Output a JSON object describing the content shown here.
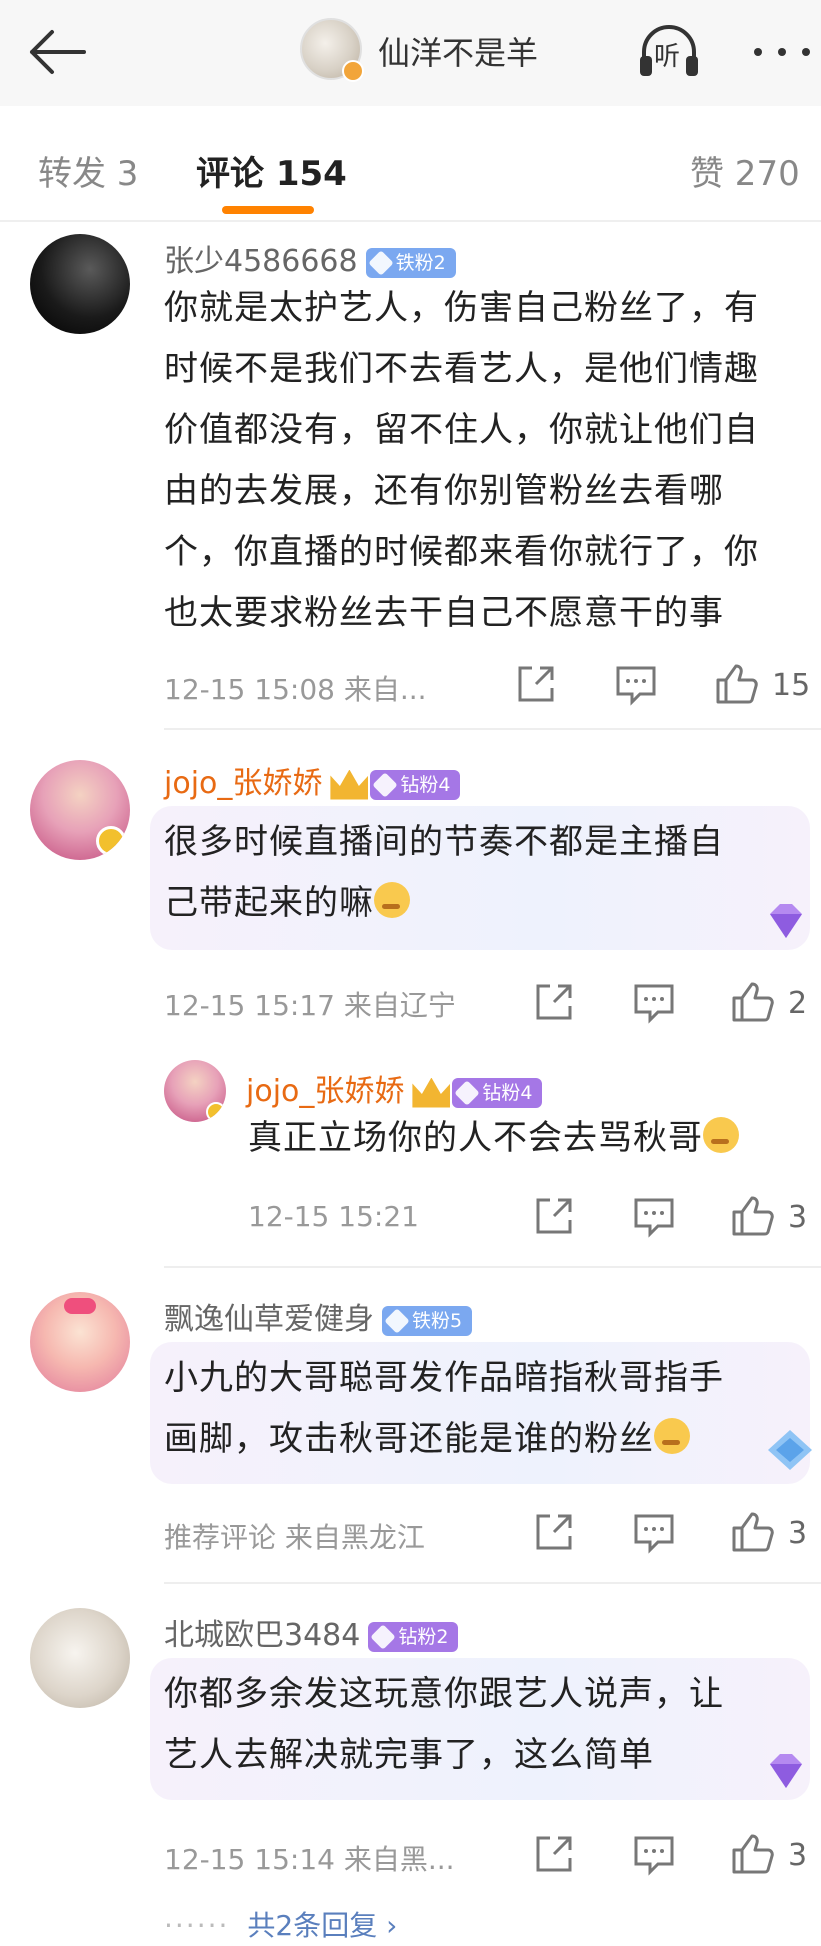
{
  "header": {
    "title": "仙洋不是羊",
    "listen_label": "听"
  },
  "tabs": {
    "repost": "转发 3",
    "comment": "评论 154",
    "like": "赞 270"
  },
  "comments": [
    {
      "username": "张少4586668",
      "badge": "铁粉2",
      "text_lines": [
        "你就是太护艺人，伤害自己粉丝了，有",
        "时候不是我们不去看艺人，是他们情趣",
        "价值都没有，留不住人，你就让他们自",
        "由的去发展，还有你别管粉丝去看哪",
        "个，你直播的时候都来看你就行了，你",
        "也太要求粉丝去干自己不愿意干的事"
      ],
      "meta": "12-15 15:08  来自...",
      "likes": "15"
    },
    {
      "username": "jojo_张娇娇",
      "badge": "钻粉4",
      "text_lines": [
        "很多时候直播间的节奏不都是主播自",
        "己带起来的嘛"
      ],
      "meta": "12-15 15:17  来自辽宁",
      "likes": "2"
    },
    {
      "username": "jojo_张娇娇",
      "badge": "钻粉4",
      "text_lines": [
        "真正立场你的人不会去骂秋哥"
      ],
      "meta": "12-15 15:21",
      "likes": "3"
    },
    {
      "username": "飘逸仙草爱健身",
      "badge": "铁粉5",
      "text_lines": [
        "小九的大哥聪哥发作品暗指秋哥指手",
        "画脚，攻击秋哥还能是谁的粉丝"
      ],
      "meta": "推荐评论  来自黑龙江",
      "likes": "3"
    },
    {
      "username": "北城欧巴3484",
      "badge": "钻粉2",
      "text_lines": [
        "你都多余发这玩意你跟艺人说声，让",
        "艺人去解决就完事了，这么简单"
      ],
      "meta": "12-15 15:14  来自黑...",
      "likes": "3"
    }
  ],
  "more_replies": "共2条回复 ›",
  "colors": {
    "accent": "#ff8200",
    "vip_name": "#e86a13",
    "iron_badge": "#7ba8f0",
    "diamond_badge": "#a577e6",
    "link": "#5a7fbd"
  }
}
